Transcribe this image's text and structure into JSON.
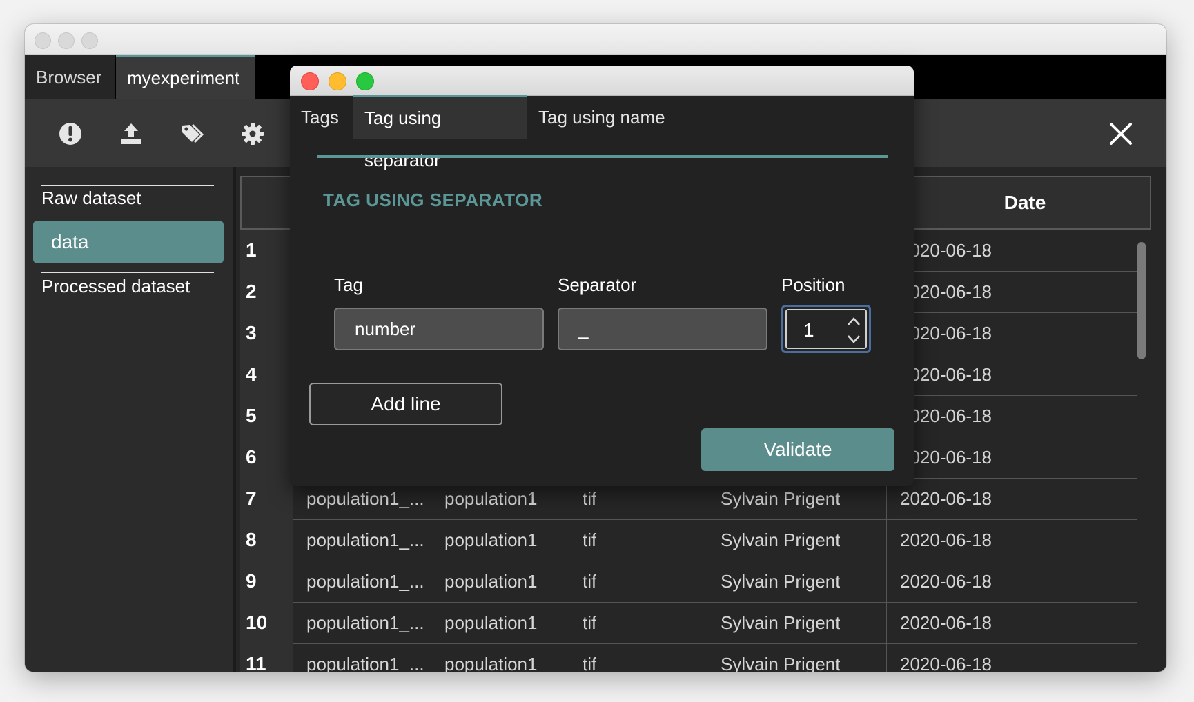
{
  "window": {
    "tabs": [
      {
        "label": "Browser"
      },
      {
        "label": "myexperiment"
      }
    ]
  },
  "toolbar": {
    "icons": [
      "alert-icon",
      "upload-icon",
      "tag-icon",
      "gear-icon",
      "close-icon"
    ]
  },
  "sidebar": {
    "items": [
      {
        "label": "Raw dataset"
      },
      {
        "label": "data"
      },
      {
        "label": "Processed dataset"
      }
    ]
  },
  "table": {
    "date_header": "Date",
    "rows": [
      {
        "idx": "1",
        "c1": "",
        "c2": "",
        "c3": "",
        "c4": "",
        "date": "2020-06-18"
      },
      {
        "idx": "2",
        "c1": "",
        "c2": "",
        "c3": "",
        "c4": "",
        "date": "2020-06-18"
      },
      {
        "idx": "3",
        "c1": "",
        "c2": "",
        "c3": "",
        "c4": "",
        "date": "2020-06-18"
      },
      {
        "idx": "4",
        "c1": "",
        "c2": "",
        "c3": "",
        "c4": "",
        "date": "2020-06-18"
      },
      {
        "idx": "5",
        "c1": "",
        "c2": "",
        "c3": "",
        "c4": "",
        "date": "2020-06-18"
      },
      {
        "idx": "6",
        "c1": "",
        "c2": "",
        "c3": "",
        "c4": "",
        "date": "2020-06-18"
      },
      {
        "idx": "7",
        "c1": "population1_...",
        "c2": "population1",
        "c3": "tif",
        "c4": "Sylvain Prigent",
        "date": "2020-06-18"
      },
      {
        "idx": "8",
        "c1": "population1_...",
        "c2": "population1",
        "c3": "tif",
        "c4": "Sylvain Prigent",
        "date": "2020-06-18"
      },
      {
        "idx": "9",
        "c1": "population1_...",
        "c2": "population1",
        "c3": "tif",
        "c4": "Sylvain Prigent",
        "date": "2020-06-18"
      },
      {
        "idx": "10",
        "c1": "population1_...",
        "c2": "population1",
        "c3": "tif",
        "c4": "Sylvain Prigent",
        "date": "2020-06-18"
      },
      {
        "idx": "11",
        "c1": "population1_...",
        "c2": "population1",
        "c3": "tif",
        "c4": "Sylvain Prigent",
        "date": "2020-06-18"
      }
    ]
  },
  "dialog": {
    "tabs": [
      {
        "label": "Tags"
      },
      {
        "label": "Tag using separator"
      },
      {
        "label": "Tag using name"
      }
    ],
    "section_title": "TAG USING SEPARATOR",
    "fields": {
      "tag_label": "Tag",
      "tag_value": "number",
      "separator_label": "Separator",
      "separator_value": "_",
      "position_label": "Position",
      "position_value": "1"
    },
    "add_line_label": "Add line",
    "validate_label": "Validate",
    "colors": {
      "accent": "#5b9797",
      "primary_button": "#5b8d8d"
    }
  }
}
